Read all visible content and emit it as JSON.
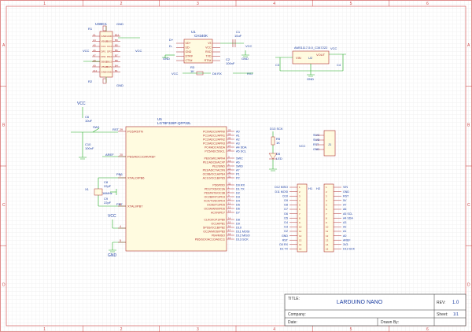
{
  "frame": {
    "col_labels": [
      "1",
      "2",
      "3",
      "4",
      "5",
      "6"
    ],
    "row_labels": [
      "A",
      "B",
      "C",
      "D"
    ]
  },
  "title_block": {
    "title_label": "TITLE:",
    "title": "LARDUINO NANO",
    "rev_label": "REV:",
    "rev": "1.0",
    "company_label": "Company:",
    "sheet_label": "Sheet:",
    "sheet": "1/1",
    "date_label": "Date:",
    "drawn_label": "Drawn By:"
  },
  "usb": {
    "ref": "USBC1",
    "gnd": "GND",
    "vcc": "VCC",
    "left_pins": [
      "A1",
      "A4",
      "A5",
      "A6",
      "A7",
      "A8",
      "A9",
      "A12"
    ],
    "left_names": [
      "GND",
      "VBUS",
      "CC1",
      "DP1",
      "DN1",
      "SBU1",
      "VBUS",
      "GND"
    ],
    "right_names": [
      "GND",
      "VBUS",
      "CC2",
      "DP2",
      "DN2",
      "SBU2",
      "VBUS",
      "GND"
    ],
    "right_pins": [
      "B12",
      "B9",
      "B5",
      "B6",
      "B7",
      "B8",
      "B4",
      "B1"
    ],
    "r_top": "R1",
    "r_bot": "R2"
  },
  "ch340": {
    "ref": "U1",
    "part": "CH340K",
    "dp": "D+",
    "dn": "D-",
    "gnd": "GND",
    "vcc": "VCC",
    "left_names": [
      "UD+",
      "UD-",
      "GND",
      "DTR#",
      "CTS#"
    ],
    "right_names": [
      "V3",
      "VCC",
      "RXD",
      "TXD",
      "RTS#"
    ],
    "c1": "C1",
    "c1_val": "10uF",
    "c2": "C2",
    "c2_val": "100nF",
    "r3": "R3",
    "r3_val": "1K",
    "d6_rx": "D6 RX",
    "rst": "RST"
  },
  "ldo": {
    "ref": "U2",
    "part": "AMS1117-5.0_C347222",
    "vin": "VIN",
    "vout": "VOUT",
    "gnd": "GND",
    "c3": "C3",
    "c4": "C4",
    "vcc": "VCC"
  },
  "mcu": {
    "ref": "U5",
    "part": "LGT8F328P-QFP32L",
    "left_pins": [
      {
        "num": "29",
        "name": "PC6/RSTN"
      },
      {
        "num": "20",
        "name": "PE6/ADC10/AVREF"
      },
      {
        "num": "7",
        "name": "XTALO/PB6"
      },
      {
        "num": "8",
        "name": "XTALI/PB7"
      },
      {
        "num": "4",
        "name": ""
      },
      {
        "num": "5",
        "name": ""
      }
    ],
    "right_pins": [
      {
        "num": "23",
        "name": "PC0/ADC0/APN0",
        "net": "A0"
      },
      {
        "num": "24",
        "name": "PC1/ADC1/APN1",
        "net": "A1"
      },
      {
        "num": "25",
        "name": "PC2/ADC2/APN2",
        "net": "A2"
      },
      {
        "num": "26",
        "name": "PC3/ADC3/APN3",
        "net": "A3"
      },
      {
        "num": "27",
        "name": "PC4/ADC4/SDA",
        "net": "A4 SDA"
      },
      {
        "num": "28",
        "name": "PC5/ADC5/SCL",
        "net": "A5 SCL"
      },
      {
        "num": "3",
        "name": "PE0/SWC/APN4",
        "net": "SWC"
      },
      {
        "num": "19",
        "name": "PE1/ADC6/ACXP",
        "net": "A6"
      },
      {
        "num": "6",
        "name": "PE2/SWD",
        "net": "SWD"
      },
      {
        "num": "22",
        "name": "PE3/ADC7/ACXN",
        "net": "A7"
      },
      {
        "num": "30",
        "name": "OC0B/OC1A/PE4",
        "net": "P1"
      },
      {
        "num": "31",
        "name": "AC1O/OC1B/PE5",
        "net": "P2"
      },
      {
        "num": "32",
        "name": "PD0/RXD",
        "net": "D0 RX"
      },
      {
        "num": "1",
        "name": "PD1/TXD/OC3A",
        "net": "D1 TX"
      },
      {
        "num": "2",
        "name": "PD2/INT0/OC3B",
        "net": "D2"
      },
      {
        "num": "9",
        "name": "OC2B/INT1/PD3",
        "net": "D3"
      },
      {
        "num": "10",
        "name": "XCK/T0/DO/PD4",
        "net": "D4"
      },
      {
        "num": "11",
        "name": "OC0B/T1/PD5",
        "net": "D5"
      },
      {
        "num": "12",
        "name": "OC0A/AIN0/PD6",
        "net": "D6"
      },
      {
        "num": "13",
        "name": "ACXN/PD7",
        "net": "D7"
      },
      {
        "num": "14",
        "name": "CLKO/ICP1/PB0",
        "net": "D8"
      },
      {
        "num": "15",
        "name": "OC1A/PB1",
        "net": "D9"
      },
      {
        "num": "16",
        "name": "SPSS/OC1B/PB2",
        "net": "D10"
      },
      {
        "num": "17",
        "name": "OC2A/MOSI/PB3",
        "net": "D11 MOSI"
      },
      {
        "num": "18",
        "name": "PB4/MISO",
        "net": "D12 MISO"
      },
      {
        "num": "19",
        "name": "PB5/SCK/AC1O/ADC11",
        "net": "D13 SCK"
      }
    ]
  },
  "reset": {
    "vcc": "VCC",
    "c": "C6",
    "c_val": "10uF",
    "sw": "SW1",
    "c2": "C10",
    "c2_val": "100nF",
    "rst": "RST",
    "aref": "AREF"
  },
  "crystal": {
    "pb6": "PB6",
    "pb7": "PB7",
    "c_a": "C8",
    "c_a_val": "22pF",
    "c_b": "C9",
    "c_b_val": "22pF",
    "x": "X1",
    "x_val": "16MHz"
  },
  "power_in": {
    "vcc": "VCC",
    "gnd": "GND"
  },
  "led": {
    "net": "D13 SCK",
    "r": "R5",
    "r_val": "1K",
    "d": "D5",
    "d_label": "LED"
  },
  "isp": {
    "ref": "J1",
    "vcc": "VCC",
    "pins": [
      "SWC",
      "SWD",
      "RST",
      "GND"
    ]
  },
  "h1": {
    "ref": "H1",
    "nets": [
      "D13 SCK",
      "3V3",
      "AREF",
      "A0",
      "A1",
      "A2",
      "A3",
      "A4 SDA",
      "A5 SCL",
      "A6",
      "A7",
      "5V",
      "RST",
      "GND",
      "VIN"
    ]
  },
  "h2": {
    "ref": "H2",
    "nets": [
      "VIN",
      "GND",
      "RST",
      "5V",
      "A7",
      "A6",
      "A5 SCL",
      "A4 SDA",
      "A3",
      "A2",
      "A1",
      "A0",
      "AREF",
      "3V3",
      "D13 SCK"
    ]
  },
  "header_left_nets": [
    "D12 MISO",
    "D11 MOSI",
    "D10",
    "D9",
    "D8",
    "D7",
    "D6",
    "D5",
    "D4",
    "D3",
    "D2",
    "GND",
    "RST",
    "D0 RX",
    "D1 TX"
  ]
}
